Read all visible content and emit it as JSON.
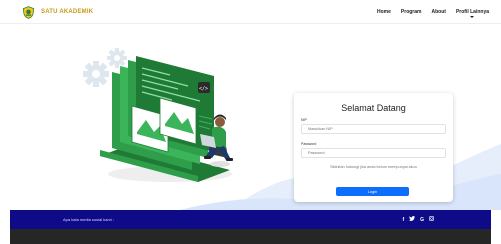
{
  "brand": {
    "name": "SATU AKADEMIK",
    "color": "#c79a1a"
  },
  "nav": {
    "items": [
      "Home",
      "Program",
      "About",
      "Profil Lainnya"
    ]
  },
  "login": {
    "title": "Selamat Datang",
    "nip_label": "NIP",
    "nip_placeholder": "Masukkan NIP",
    "password_label": "Password",
    "password_placeholder": "Password",
    "hint": "Silahkan hubungi jika anda belum mempunyai akun",
    "button": "Login",
    "button_color": "#0d6efd"
  },
  "footer": {
    "text": "Apa kata media sosial kami :",
    "social_icons": [
      "facebook-icon",
      "twitter-icon",
      "google-icon",
      "instagram-icon"
    ],
    "color": "#0f0a87"
  }
}
